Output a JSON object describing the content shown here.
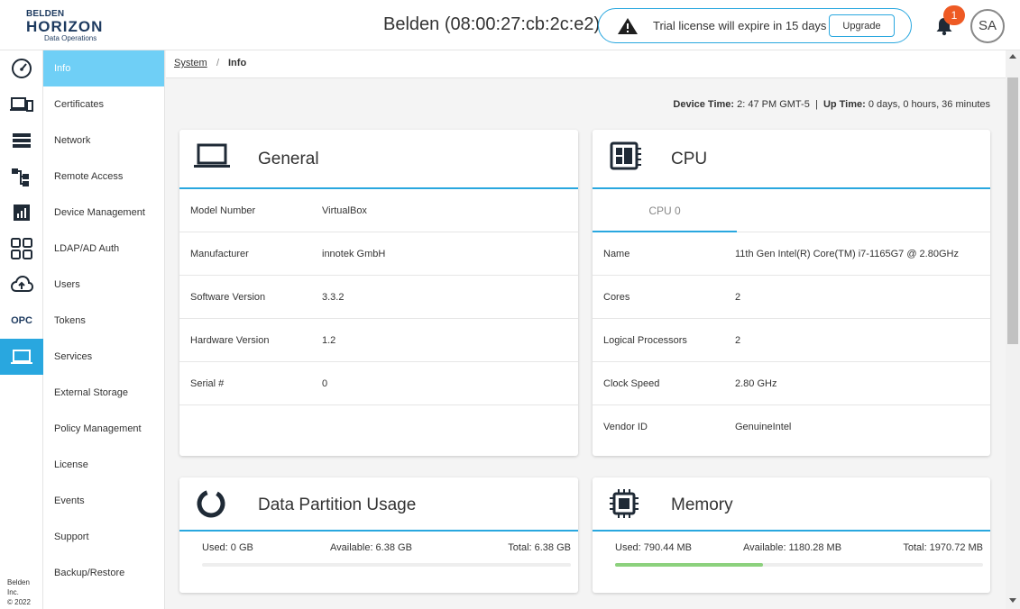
{
  "brand": {
    "line1": "BELDEN",
    "line2": "HORIZON",
    "line3": "Data Operations"
  },
  "header": {
    "device_title": "Belden (08:00:27:cb:2c:e2)",
    "trial_text": "Trial license will expire in 15 days",
    "upgrade_label": "Upgrade",
    "notification_count": "1",
    "avatar_initials": "SA"
  },
  "rail": {
    "items": [
      "gauge-icon",
      "devices-icon",
      "list-icon",
      "topology-icon",
      "chart-icon",
      "apps-icon",
      "cloud-upload-icon",
      "opc",
      "laptop-icon"
    ],
    "opc_label": "OPC",
    "copyright_line1": "Belden Inc.",
    "copyright_line2": "© 2022"
  },
  "subnav": {
    "items": [
      "Info",
      "Certificates",
      "Network",
      "Remote Access",
      "Device Management",
      "LDAP/AD Auth",
      "Users",
      "Tokens",
      "Services",
      "External Storage",
      "Policy Management",
      "License",
      "Events",
      "Support",
      "Backup/Restore"
    ],
    "active": "Info"
  },
  "breadcrumb": {
    "parent": "System",
    "separator": "/",
    "current": "Info"
  },
  "status": {
    "device_time_label": "Device Time:",
    "device_time_value": "2: 47 PM GMT-5",
    "divider": "|",
    "up_time_label": "Up Time:",
    "up_time_value": "0 days, 0 hours, 36 minutes"
  },
  "general": {
    "title": "General",
    "rows": [
      {
        "key": "Model Number",
        "value": "VirtualBox"
      },
      {
        "key": "Manufacturer",
        "value": "innotek GmbH"
      },
      {
        "key": "Software Version",
        "value": "3.3.2"
      },
      {
        "key": "Hardware Version",
        "value": "1.2"
      },
      {
        "key": "Serial #",
        "value": "0"
      }
    ]
  },
  "cpu": {
    "title": "CPU",
    "tab": "CPU 0",
    "rows": [
      {
        "key": "Name",
        "value": "11th Gen Intel(R) Core(TM) i7-1165G7 @ 2.80GHz"
      },
      {
        "key": "Cores",
        "value": "2"
      },
      {
        "key": "Logical Processors",
        "value": "2"
      },
      {
        "key": "Clock Speed",
        "value": "2.80 GHz"
      },
      {
        "key": "Vendor ID",
        "value": "GenuineIntel"
      }
    ]
  },
  "partition": {
    "title": "Data Partition Usage",
    "used": "Used: 0 GB",
    "available": "Available: 6.38 GB",
    "total": "Total: 6.38 GB",
    "used_fraction": 0
  },
  "memory": {
    "title": "Memory",
    "used": "Used: 790.44 MB",
    "available": "Available: 1180.28 MB",
    "total": "Total: 1970.72 MB",
    "used_fraction": 0.401
  },
  "colors": {
    "accent": "#29a7df",
    "active_sub": "#6fcff6",
    "badge": "#ee5a24",
    "usage_fill": "#8cd17d",
    "navy": "#1d3a5f"
  }
}
